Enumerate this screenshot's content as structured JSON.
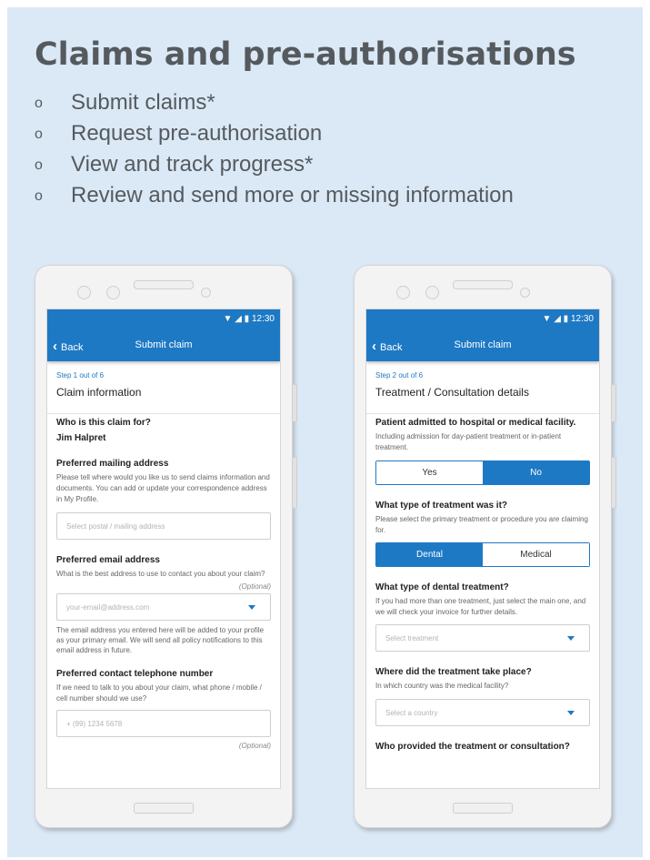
{
  "heading": "Claims and pre-authorisations",
  "bullet_mark": "o",
  "bullets": [
    "Submit claims*",
    "Request pre-authorisation",
    "View and track progress*",
    "Review and send more or missing information"
  ],
  "colors": {
    "panel": "#dbe9f6",
    "brand": "#1e79c4",
    "heading": "#555a5f"
  },
  "phone1": {
    "status_time": "12:30",
    "back_label": "Back",
    "title": "Submit claim",
    "step": "Step 1 out of 6",
    "section_title": "Claim information",
    "who_label": "Who is this claim for?",
    "who_value": "Jim Halpret",
    "mail_label": "Preferred mailing address",
    "mail_help": "Please tell where would you like us to send claims information and documents. You can add or update your correspondence address in My Profile.",
    "mail_placeholder": "Select postal / mailing address",
    "email_label": "Preferred email address",
    "email_help": "What is the best address to use to contact you about your claim?",
    "email_optional": "(Optional)",
    "email_placeholder": "your-email@address.com",
    "email_note": "The email address you entered here will be added to your profile as your primary email. We will send all policy notifications to this email address in future.",
    "phone_label": "Preferred contact telephone number",
    "phone_help": "If we need to talk to you about your claim, what phone / mobile / cell number should we use?",
    "phone_placeholder": "+ (99) 1234 5678",
    "phone_optional": "(Optional)"
  },
  "phone2": {
    "status_time": "12:30",
    "back_label": "Back",
    "title": "Submit claim",
    "step": "Step 2 out of 6",
    "section_title": "Treatment / Consultation details",
    "admitted_label": "Patient admitted to hospital or medical facility.",
    "admitted_help": "Including admission for day-patient treatment or in-patient treatment.",
    "yes_label": "Yes",
    "no_label": "No",
    "selected_admitted": "No",
    "type_label": "What type of treatment was it?",
    "type_help": "Please select the primary treatment or procedure you are claiming for.",
    "dental_label": "Dental",
    "medical_label": "Medical",
    "selected_type": "Dental",
    "dental_type_label": "What type of dental treatment?",
    "dental_type_help": "If you had more than one treatment, just select the main one, and we will check your invoice for further details.",
    "treatment_placeholder": "Select treatment",
    "where_label": "Where did the treatment take place?",
    "where_help": "In which country was the medical facility?",
    "country_placeholder": "Select a country",
    "who_provided_label": "Who provided the treatment or consultation?"
  }
}
